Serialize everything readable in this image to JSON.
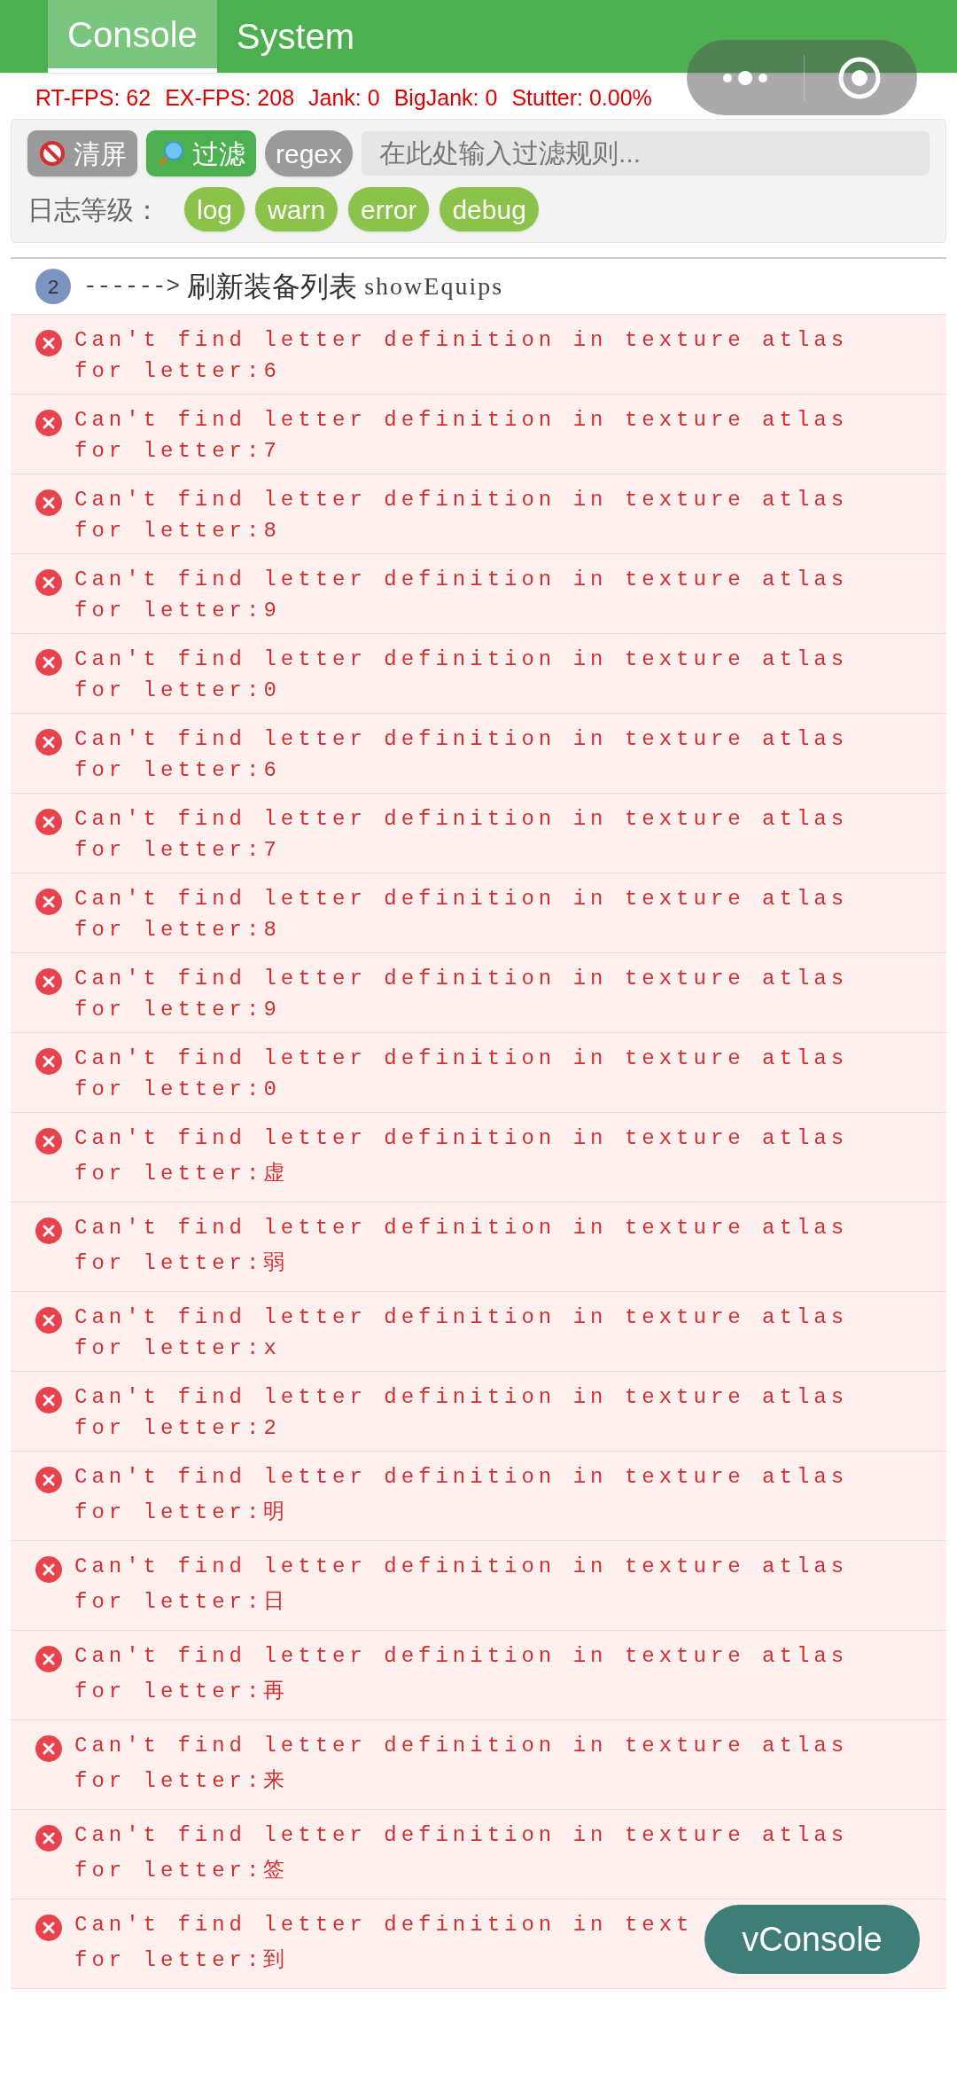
{
  "tabs": [
    {
      "label": "Console",
      "selected": true
    },
    {
      "label": "System",
      "selected": false
    }
  ],
  "toolbar": {
    "buttons": [
      {
        "kind": "clear",
        "label": "清屏"
      },
      {
        "kind": "filter",
        "label": "过滤"
      },
      {
        "kind": "regex",
        "label": "regex"
      }
    ],
    "filter_field": {
      "placeholder": "在此处输入过滤规则..."
    }
  },
  "log_levels": {
    "label": "日志等级：",
    "levels": [
      "log",
      "warn",
      "error",
      "debug"
    ]
  },
  "log_entry": {
    "count": "2",
    "arrow": "------>",
    "text": "刷新装备列表",
    "code": "showEquips"
  },
  "errors": [
    {
      "message": "Can't find letter definition in texture atlas",
      "detail": "for letter:6",
      "tall": false
    },
    {
      "message": "Can't find letter definition in texture atlas",
      "detail": "for letter:7",
      "tall": false
    },
    {
      "message": "Can't find letter definition in texture atlas",
      "detail": "for letter:8",
      "tall": false
    },
    {
      "message": "Can't find letter definition in texture atlas",
      "detail": "for letter:9",
      "tall": false
    },
    {
      "message": "Can't find letter definition in texture atlas",
      "detail": "for letter:0",
      "tall": false
    },
    {
      "message": "Can't find letter definition in texture atlas",
      "detail": "for letter:6",
      "tall": false
    },
    {
      "message": "Can't find letter definition in texture atlas",
      "detail": "for letter:7",
      "tall": false
    },
    {
      "message": "Can't find letter definition in texture atlas",
      "detail": "for letter:8",
      "tall": false
    },
    {
      "message": "Can't find letter definition in texture atlas",
      "detail": "for letter:9",
      "tall": false
    },
    {
      "message": "Can't find letter definition in texture atlas",
      "detail": "for letter:0",
      "tall": false
    },
    {
      "message": "Can't find letter definition in texture atlas",
      "detail": "for letter:虚",
      "tall": true
    },
    {
      "message": "Can't find letter definition in texture atlas",
      "detail": "for letter:弱",
      "tall": true
    },
    {
      "message": "Can't find letter definition in texture atlas",
      "detail": "for letter:x",
      "tall": false
    },
    {
      "message": "Can't find letter definition in texture atlas",
      "detail": "for letter:2",
      "tall": false
    },
    {
      "message": "Can't find letter definition in texture atlas",
      "detail": "for letter:明",
      "tall": true
    },
    {
      "message": "Can't find letter definition in texture atlas",
      "detail": "for letter:日",
      "tall": true
    },
    {
      "message": "Can't find letter definition in texture atlas",
      "detail": "for letter:再",
      "tall": true
    },
    {
      "message": "Can't find letter definition in texture atlas",
      "detail": "for letter:来",
      "tall": true
    },
    {
      "message": "Can't find letter definition in texture atlas",
      "detail": "for letter:签",
      "tall": true
    },
    {
      "message": "Can't find letter definition in text",
      "detail": "for letter:到",
      "tall": true
    }
  ],
  "perf_overlay": [
    "RT-FPS: 62",
    "EX-FPS: 208",
    "Jank: 0",
    "BigJank: 0",
    "Stutter: 0.00%"
  ],
  "vconsole_button": "vConsole"
}
